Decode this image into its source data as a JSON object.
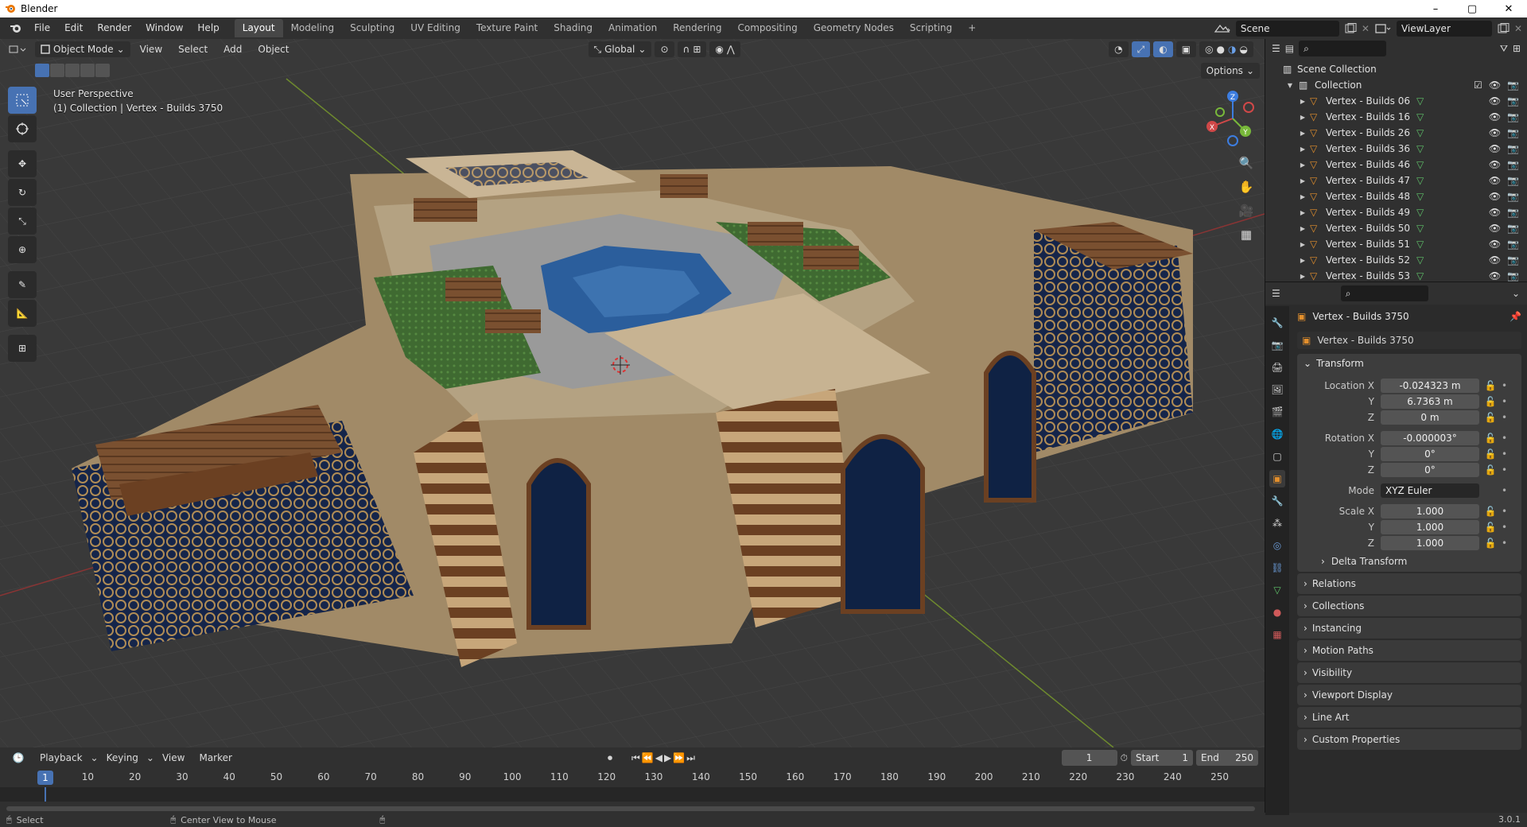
{
  "window": {
    "title": "Blender",
    "min": "–",
    "max": "▢",
    "close": "✕"
  },
  "menu": [
    "File",
    "Edit",
    "Render",
    "Window",
    "Help"
  ],
  "workspaces": [
    "Layout",
    "Modeling",
    "Sculpting",
    "UV Editing",
    "Texture Paint",
    "Shading",
    "Animation",
    "Rendering",
    "Compositing",
    "Geometry Nodes",
    "Scripting"
  ],
  "workspace_add": "+",
  "scene": {
    "name": "Scene",
    "view_layer": "ViewLayer"
  },
  "viewport": {
    "mode": "Object Mode",
    "header_menus": [
      "View",
      "Select",
      "Add",
      "Object"
    ],
    "orientation": "Global",
    "options": "Options",
    "overlay_line1": "User Perspective",
    "overlay_line2": "(1) Collection | Vertex - Builds 3750",
    "gizmo": {
      "x": "X",
      "y": "Y",
      "z": "Z"
    }
  },
  "timeline": {
    "menus": [
      "Playback",
      "Keying",
      "View",
      "Marker"
    ],
    "current_frame": "1",
    "start_label": "Start",
    "start": "1",
    "end_label": "End",
    "end": "250",
    "ruler": [
      "1",
      "10",
      "20",
      "30",
      "40",
      "50",
      "60",
      "70",
      "80",
      "90",
      "100",
      "110",
      "120",
      "130",
      "140",
      "150",
      "160",
      "170",
      "180",
      "190",
      "200",
      "210",
      "220",
      "230",
      "240",
      "250"
    ]
  },
  "statusbar": {
    "select": "Select",
    "center": "Center View to Mouse",
    "version": "3.0.1"
  },
  "outliner": {
    "scene_collection": "Scene Collection",
    "collection": "Collection",
    "items": [
      "Vertex - Builds 06",
      "Vertex - Builds 16",
      "Vertex - Builds 26",
      "Vertex - Builds 36",
      "Vertex - Builds 46",
      "Vertex - Builds 47",
      "Vertex - Builds 48",
      "Vertex - Builds 49",
      "Vertex - Builds 50",
      "Vertex - Builds 51",
      "Vertex - Builds 52",
      "Vertex - Builds 53"
    ]
  },
  "properties": {
    "object_name": "Vertex - Builds 3750",
    "field_name": "Vertex - Builds 3750",
    "transform_title": "Transform",
    "location": {
      "label": "Location X",
      "x": "-0.024323 m",
      "y": "6.7363 m",
      "z": "0 m"
    },
    "rotation": {
      "label": "Rotation X",
      "x": "-0.000003°",
      "y": "0°",
      "z": "0°"
    },
    "axis_y": "Y",
    "axis_z": "Z",
    "mode_label": "Mode",
    "mode_value": "XYZ Euler",
    "scale": {
      "label": "Scale X",
      "x": "1.000",
      "y": "1.000",
      "z": "1.000"
    },
    "delta": "Delta Transform",
    "panels": [
      "Relations",
      "Collections",
      "Instancing",
      "Motion Paths",
      "Visibility",
      "Viewport Display",
      "Line Art",
      "Custom Properties"
    ]
  },
  "colors": {
    "accent": "#4772b3",
    "header": "#303030",
    "viewport": "#393939",
    "orange": "#e38f2c",
    "green": "#5fc36a"
  }
}
